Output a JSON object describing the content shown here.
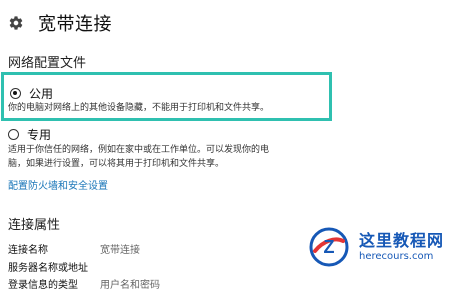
{
  "header": {
    "title": "宽带连接",
    "icon": "gear-icon"
  },
  "network_profile": {
    "section_title": "网络配置文件",
    "public": {
      "label": "公用",
      "description": "你的电脑对网络上的其他设备隐藏，不能用于打印机和文件共享。",
      "selected": true
    },
    "private": {
      "label": "专用",
      "description_line1": "适用于你信任的网络，例如在家中或在工作单位。可以发现你的电",
      "description_line2": "脑，如果进行设置，可以将其用于打印机和文件共享。",
      "selected": false
    },
    "accent_color": "#2fc0b0"
  },
  "firewall_link": "配置防火墙和安全设置",
  "connection_properties": {
    "title": "连接属性",
    "rows": [
      {
        "label": "连接名称",
        "value": "宽带连接"
      },
      {
        "label": "服务器名称或地址",
        "value": ""
      },
      {
        "label": "登录信息的类型",
        "value": "用户名和密码"
      }
    ]
  },
  "watermark": {
    "title": "这里教程网",
    "url": "herecours.com",
    "brand_color": "#0a50b3"
  }
}
